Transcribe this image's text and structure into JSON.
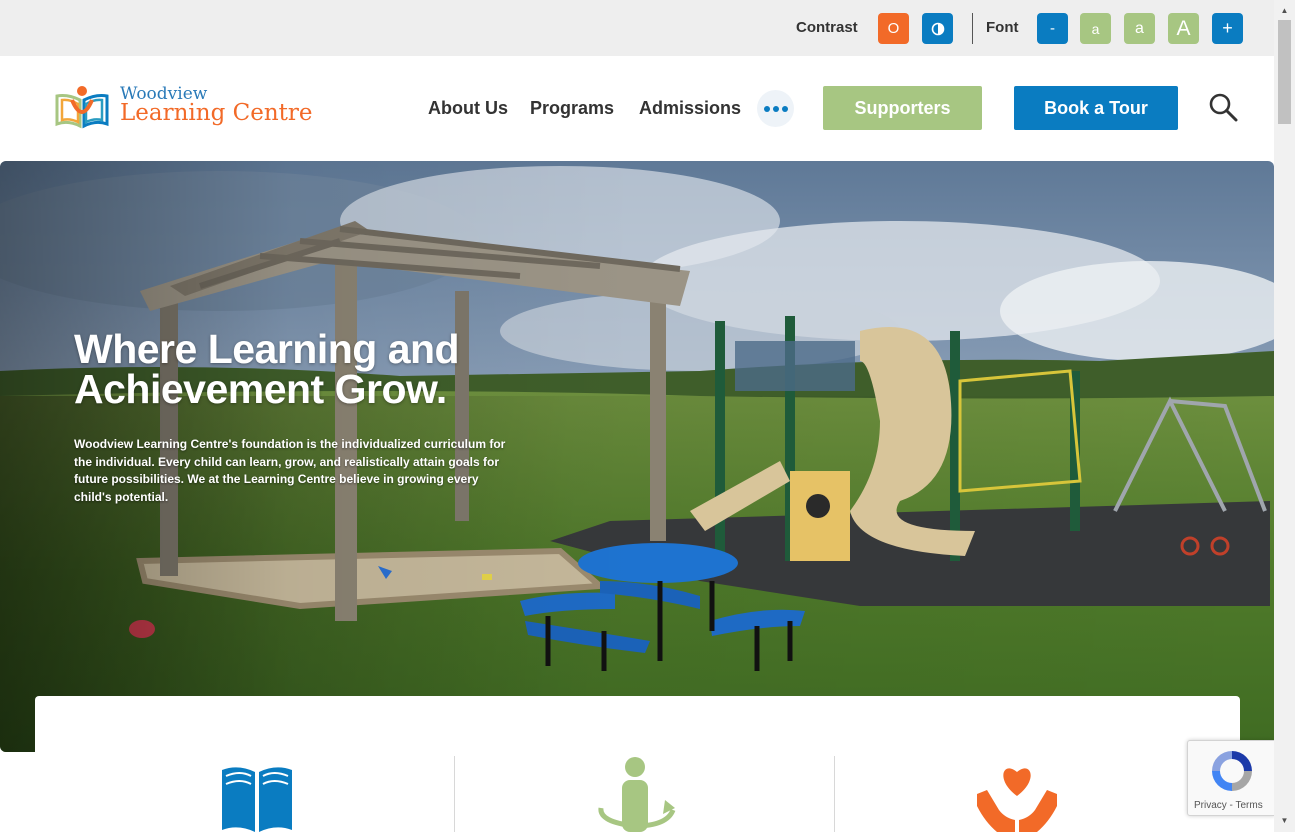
{
  "accessibility": {
    "contrast_label": "Contrast",
    "contrast_off": "O",
    "font_label": "Font",
    "font_decrease": "-",
    "font_small": "a",
    "font_medium": "a",
    "font_large": "A",
    "font_increase": "+"
  },
  "logo": {
    "line1": "Woodview",
    "line2": "Learning Centre"
  },
  "nav": {
    "items": [
      "About Us",
      "Programs",
      "Admissions"
    ],
    "supporters": "Supporters",
    "book_tour": "Book a Tour"
  },
  "hero": {
    "title": "Where Learning and Achievement Grow.",
    "text": "Woodview Learning Centre's foundation is the individualized curriculum for the individual. Every child can learn, grow, and realistically attain goals for future possibilities. We at the Learning Centre believe in growing every child's potential."
  },
  "recaptcha": {
    "terms": "Privacy - Terms"
  },
  "colors": {
    "orange": "#f26a28",
    "blue": "#0a7cc1",
    "green": "#a7c682"
  }
}
